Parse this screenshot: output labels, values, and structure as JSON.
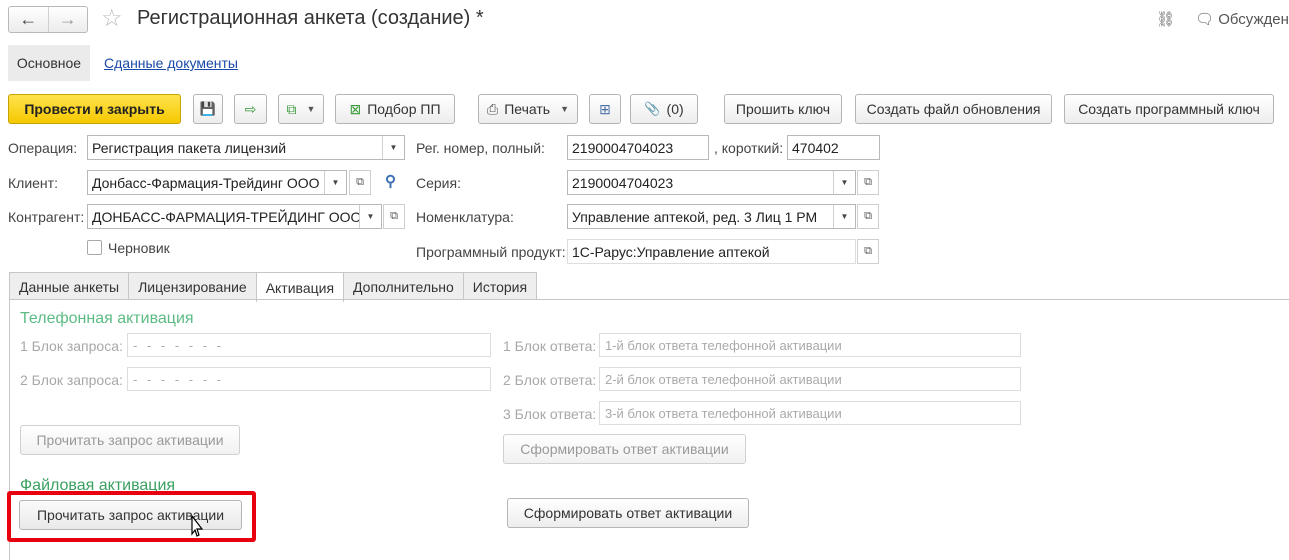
{
  "window": {
    "title": "Регистрационная анкета (создание) *",
    "back_icon": "←",
    "forward_icon": "→",
    "favorite_icon": "☆",
    "link_icon": "⛓",
    "discuss_label": "Обсуждени"
  },
  "nav_tabs": {
    "main": "Основное",
    "submitted_docs": "Сданные документы"
  },
  "toolbar": {
    "post_close": "Провести и закрыть",
    "save_icon": "💾",
    "post_icon": "⇨",
    "copy_icon": "⧉",
    "select_pp": "Подбор ПП",
    "print": "Печать",
    "structure_icon": "⊞",
    "attachments": "(0)",
    "attach_icon": "📎",
    "flash_key": "Прошить ключ",
    "create_update_file": "Создать файл обновления",
    "create_program_key": "Создать программный ключ"
  },
  "form": {
    "operation_label": "Операция:",
    "operation_value": "Регистрация пакета лицензий",
    "client_label": "Клиент:",
    "client_value": "Донбасс-Фармация-Трейдинг ООО",
    "counterparty_label": "Контрагент:",
    "counterparty_value": "ДОНБАСС-ФАРМАЦИЯ-ТРЕЙДИНГ ООО",
    "draft_label": "Черновик",
    "reg_full_label": "Рег. номер, полный:",
    "reg_full_value": "2190004704023",
    "reg_short_label": ", короткий:",
    "reg_short_value": "470402",
    "series_label": "Серия:",
    "series_value": "2190004704023",
    "nomenclature_label": "Номенклатура:",
    "nomenclature_value": "Управление аптекой, ред. 3 Лиц 1 РМ",
    "program_label": "Программный продукт:",
    "program_value": "1С-Рарус:Управление аптекой"
  },
  "tabs": [
    "Данные анкеты",
    "Лицензирование",
    "Активация",
    "Дополнительно",
    "История"
  ],
  "activation": {
    "phone_title": "Телефонная активация",
    "req1_label": "1 Блок запроса:",
    "req1_value": "- - - - - - -",
    "req2_label": "2 Блок запроса:",
    "req2_value": "- - - - - - -",
    "ans1_label": "1 Блок ответа:",
    "ans1_placeholder": "1-й блок ответа телефонной активации",
    "ans2_label": "2 Блок ответа:",
    "ans2_placeholder": "2-й блок ответа телефонной активации",
    "ans3_label": "3 Блок ответа:",
    "ans3_placeholder": "3-й блок ответа телефонной активации",
    "read_request_phone": "Прочитать запрос активации",
    "form_answer_phone": "Сформировать ответ активации",
    "file_title": "Файловая активация",
    "read_request_file": "Прочитать запрос активации",
    "form_answer_file": "Сформировать ответ активации"
  }
}
